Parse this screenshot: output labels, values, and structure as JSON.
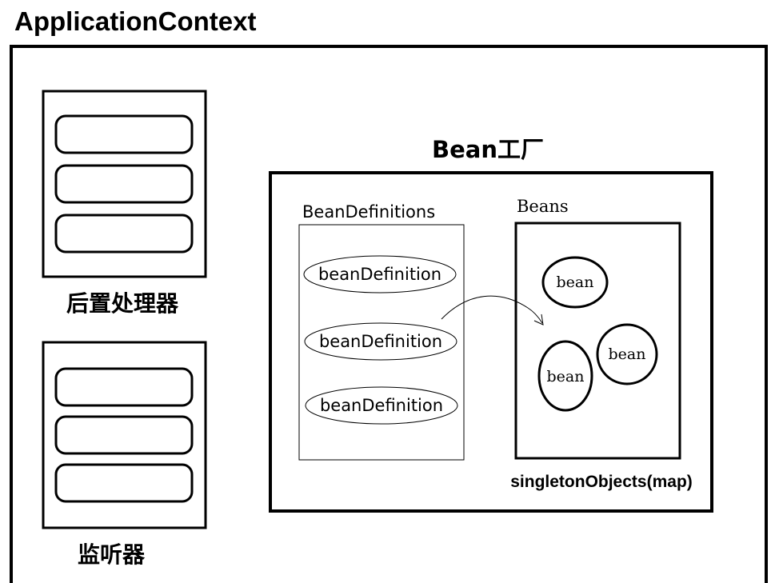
{
  "app_title": "ApplicationContext",
  "post_processor_label": "后置处理器",
  "listener_label": "监听器",
  "bean_factory_title": "Bean工厂",
  "bean_definitions": {
    "header": "BeanDefinitions",
    "items": [
      "beanDefinition",
      "beanDefinition",
      "beanDefinition"
    ]
  },
  "beans": {
    "header": "Beans",
    "items": [
      "bean",
      "bean",
      "bean"
    ],
    "caption": "singletonObjects(map)"
  }
}
